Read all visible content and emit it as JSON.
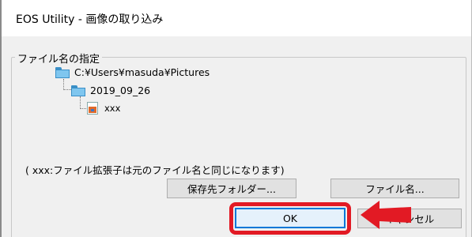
{
  "window": {
    "title": "EOS Utility - 画像の取り込み"
  },
  "file_name_group": {
    "legend": "ファイル名の指定",
    "tree": {
      "root_path": "C:¥Users¥masuda¥Pictures",
      "subfolder": "2019_09_26",
      "file": "xxx"
    },
    "note": "( xxx:ファイル拡張子は元のファイル名と同じになります)",
    "buttons": {
      "save_folder": "保存先フォルダー...",
      "file_name": "ファイル名..."
    }
  },
  "dialog_buttons": {
    "ok": "OK",
    "cancel": "キャンセル"
  },
  "annotation": {
    "highlight_color": "#e21a24",
    "arrow_color": "#e21a24",
    "highlight_target": "ok-button"
  }
}
